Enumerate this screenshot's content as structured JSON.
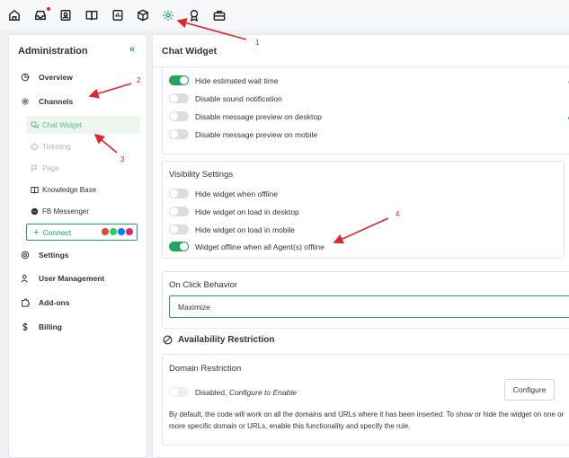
{
  "topbar": {
    "icons": [
      "home-icon",
      "inbox-icon",
      "contacts-icon",
      "knowledge-book-icon",
      "reports-icon",
      "cube-icon",
      "settings-gear-icon",
      "award-icon",
      "briefcase-icon"
    ],
    "active_icon": "settings-gear-icon"
  },
  "sidebar": {
    "title": "Administration",
    "collapse_glyph": "«",
    "items": {
      "overview": "Overview",
      "channels": "Channels",
      "chat_widget": "Chat Widget",
      "ticketing": "Ticketing",
      "page": "Page",
      "knowledge_base": "Knowledge Base",
      "fb_messenger": "FB Messenger",
      "connect": "Connect",
      "settings": "Settings",
      "user_management": "User Management",
      "add_ons": "Add-ons",
      "billing": "Billing"
    }
  },
  "main": {
    "title": "Chat Widget",
    "general_toggles": [
      {
        "label": "Hide estimated wait time",
        "on": true
      },
      {
        "label": "Disable sound notification",
        "on": false
      },
      {
        "label": "Disable message preview on desktop",
        "on": false
      },
      {
        "label": "Disable message preview on mobile",
        "on": false
      }
    ],
    "visibility": {
      "title": "Visibility Settings",
      "toggles": [
        {
          "label": "Hide widget when offline",
          "on": false
        },
        {
          "label": "Hide widget on load in desktop",
          "on": false
        },
        {
          "label": "Hide widget on load in mobile",
          "on": false
        },
        {
          "label": "Widget offline when all Agent(s) offline",
          "on": true
        }
      ]
    },
    "on_click": {
      "title": "On Click Behavior",
      "value": "Maximize"
    },
    "availability": {
      "title": "Availability Restriction"
    },
    "domain": {
      "title": "Domain Restriction",
      "status_prefix": "Disabled,",
      "status_suffix": "Configure to Enable",
      "button": "Configure",
      "description": "By default, the code will work on all the domains and URLs where it has been inserted. To show or hide the widget on one or more specific domain or URLs, enable this functionality and specify the rule."
    }
  },
  "annotations": [
    "1",
    "2",
    "3",
    "4"
  ],
  "colors": {
    "accent": "#22a45d",
    "annotation": "#e0262d"
  }
}
